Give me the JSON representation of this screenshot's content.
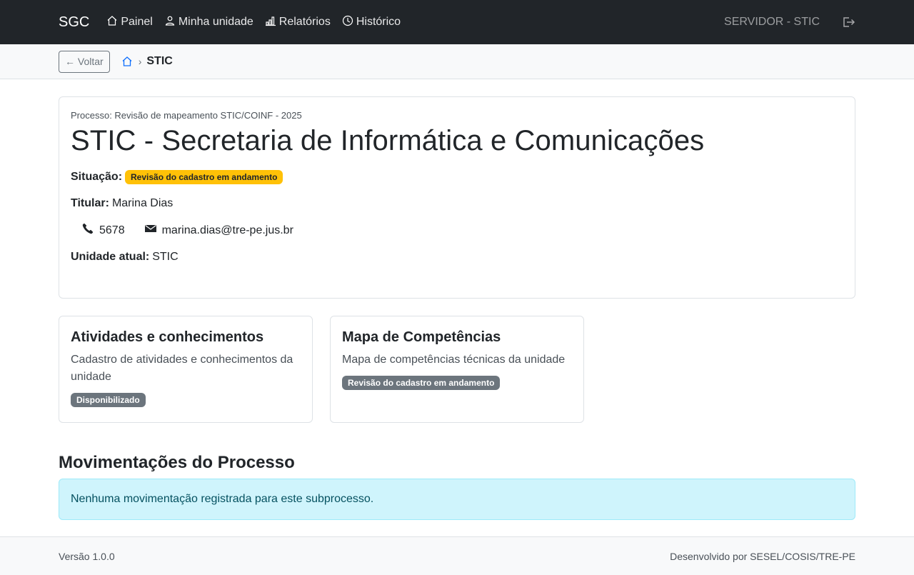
{
  "navbar": {
    "brand": "SGC",
    "links": [
      {
        "label": "Painel",
        "icon": "house-icon"
      },
      {
        "label": "Minha unidade",
        "icon": "person-icon"
      },
      {
        "label": "Relatórios",
        "icon": "bar-chart-icon"
      },
      {
        "label": "Histórico",
        "icon": "clock-icon"
      }
    ],
    "user": "SERVIDOR - STIC",
    "logout_icon": "logout-icon"
  },
  "breadcrumb": {
    "back_label": "← Voltar",
    "separator": "›",
    "current": "STIC"
  },
  "unit": {
    "process_label": "Processo: Revisão de mapeamento STIC/COINF - 2025",
    "title": "STIC - Secretaria de Informática e Comunicações",
    "situacao_label": "Situação:",
    "situacao_value": "Revisão do cadastro em andamento",
    "titular_label": "Titular:",
    "titular_value": "Marina Dias",
    "phone": "5678",
    "email": "marina.dias@tre-pe.jus.br",
    "unidade_atual_label": "Unidade atual:",
    "unidade_atual_value": "STIC"
  },
  "cards": [
    {
      "title": "Atividades e conhecimentos",
      "description": "Cadastro de atividades e conhecimentos da unidade",
      "status": "Disponibilizado"
    },
    {
      "title": "Mapa de Competências",
      "description": "Mapa de competências técnicas da unidade",
      "status": "Revisão do cadastro em andamento"
    }
  ],
  "movimentacoes": {
    "title": "Movimentações do Processo",
    "empty_message": "Nenhuma movimentação registrada para este subprocesso."
  },
  "footer": {
    "version": "Versão 1.0.0",
    "credits": "Desenvolvido por SESEL/COSIS/TRE-PE"
  },
  "colors": {
    "navbar": "#212529",
    "warning_badge": "#ffc107",
    "secondary_badge": "#6c757d",
    "info_alert": "#cff4fc",
    "link_blue": "#0d6efd"
  }
}
